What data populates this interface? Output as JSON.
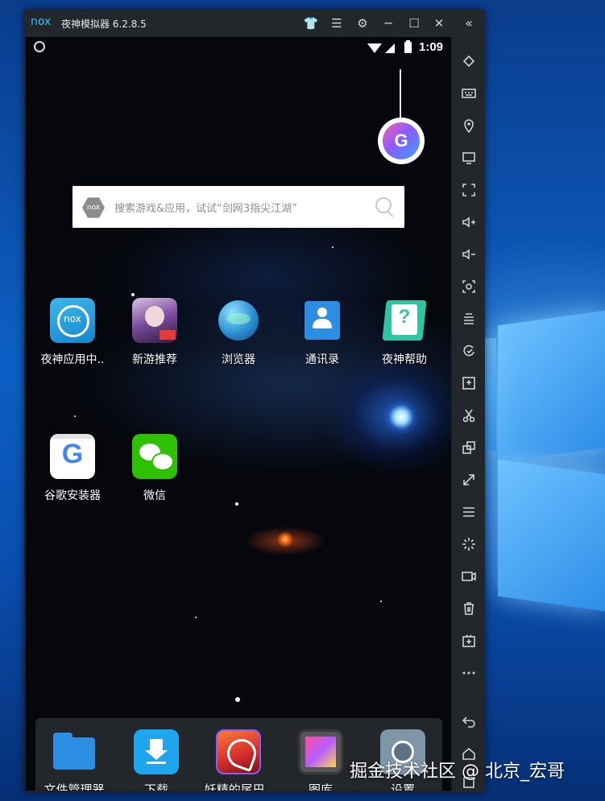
{
  "window": {
    "logo": "nox",
    "title": "夜神模拟器 6.2.8.5"
  },
  "titlebar_buttons": [
    {
      "name": "skin-icon",
      "glyph": "👕"
    },
    {
      "name": "menu-icon",
      "glyph": "☰"
    },
    {
      "name": "settings-icon",
      "glyph": "⚙"
    },
    {
      "name": "minimize-icon",
      "glyph": "─"
    },
    {
      "name": "maximize-icon",
      "glyph": "☐"
    },
    {
      "name": "close-icon",
      "glyph": "✕"
    }
  ],
  "collapse_glyph": "«",
  "status_bar": {
    "time": "1:09"
  },
  "bubble_letter": "G",
  "search": {
    "placeholder": "搜索游戏&应用，试试“剑网3指尖江湖”",
    "brand": "nox"
  },
  "home_apps": [
    {
      "name": "夜神应用中..",
      "icon": "nox-store-icon"
    },
    {
      "name": "新游推荐",
      "icon": "new-game-icon"
    },
    {
      "name": "浏览器",
      "icon": "browser-icon"
    },
    {
      "name": "通讯录",
      "icon": "contacts-icon"
    },
    {
      "name": "夜神帮助",
      "icon": "help-icon"
    },
    {
      "name": "谷歌安装器",
      "icon": "google-installer-icon"
    },
    {
      "name": "微信",
      "icon": "wechat-icon"
    }
  ],
  "dock_apps": [
    {
      "name": "文件管理器",
      "icon": "file-manager-icon"
    },
    {
      "name": "下载",
      "icon": "download-icon"
    },
    {
      "name": "妖精的尾巴..",
      "icon": "fairy-tail-icon"
    },
    {
      "name": "图库",
      "icon": "gallery-icon"
    },
    {
      "name": "设置",
      "icon": "settings-app-icon"
    }
  ],
  "sidebar_tools": [
    "rotate-icon",
    "keyboard-icon",
    "location-icon",
    "screen-icon",
    "fullscreen-icon",
    "volume-up-icon",
    "volume-down-icon",
    "screenshot-icon",
    "multi-instance-icon",
    "sync-icon",
    "fps-icon",
    "scissors-icon",
    "multi-window-icon",
    "scale-icon",
    "more-menu-icon",
    "shake-icon",
    "record-icon",
    "delete-icon",
    "apk-icon",
    "ellipsis-icon",
    "back-icon",
    "home-icon",
    "recent-icon"
  ],
  "watermark": "掘金技术社区 @ 北京_宏哥"
}
